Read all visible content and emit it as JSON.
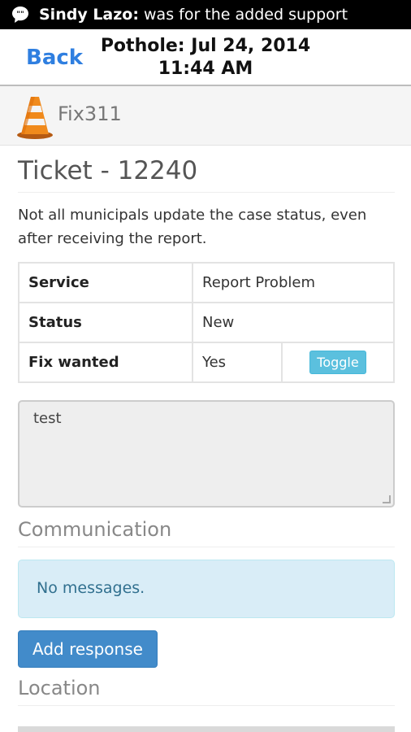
{
  "status_bar": {
    "sender": "Sindy Lazo:",
    "message": " was for the added support"
  },
  "nav": {
    "back_label": "Back",
    "title_line1": "Pothole: Jul 24, 2014",
    "title_line2": "11:44 AM"
  },
  "brand": {
    "name": "Fix311"
  },
  "ticket": {
    "title": "Ticket - 12240",
    "description": "Not all municipals update the case status, even after receiving the report.",
    "rows": [
      {
        "key": "Service",
        "value": "Report Problem"
      },
      {
        "key": "Status",
        "value": "New"
      },
      {
        "key": "Fix wanted",
        "value": "Yes",
        "action": "Toggle"
      }
    ],
    "notes": "test"
  },
  "communication": {
    "heading": "Communication",
    "empty_message": "No messages.",
    "add_button": "Add response"
  },
  "location": {
    "heading": "Location"
  }
}
